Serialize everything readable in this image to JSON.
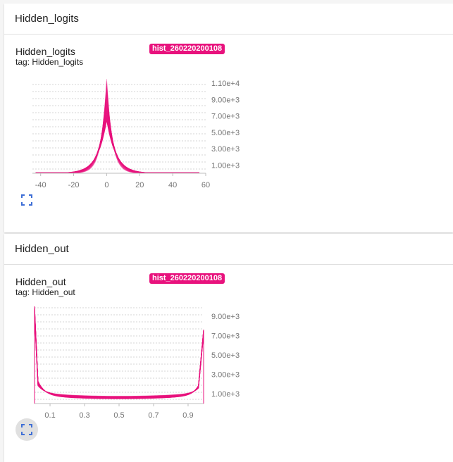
{
  "sections": [
    {
      "header": "Hidden_logits",
      "card": {
        "title": "Hidden_logits",
        "tag": "tag: Hidden_logits",
        "run": "hist_260220200108",
        "expand_icon": "fullscreen-icon"
      }
    },
    {
      "header": "Hidden_out",
      "card": {
        "title": "Hidden_out",
        "tag": "tag: Hidden_out",
        "run": "hist_260220200108",
        "expand_icon": "fullscreen-icon"
      }
    }
  ],
  "colors": {
    "run": "#e8127d",
    "curve": "#e8127d",
    "icon": "#3f6fd6"
  },
  "chart_data": [
    {
      "type": "line",
      "title": "Hidden_logits",
      "x_ticks": [
        -40,
        -20,
        0,
        20,
        40,
        60
      ],
      "y_ticks": [
        "1.00e+3",
        "3.00e+3",
        "5.00e+3",
        "7.00e+3",
        "9.00e+3",
        "1.10e+4"
      ],
      "xlim": [
        -45,
        60
      ],
      "ylim": [
        0,
        11000
      ],
      "series_count": 24,
      "peak_range": [
        6500,
        11500
      ],
      "peak_at": 0,
      "x_extent": [
        -43,
        56
      ]
    },
    {
      "type": "line",
      "title": "Hidden_out",
      "x_ticks": [
        "0.1",
        "0.3",
        "0.5",
        "0.7",
        "0.9"
      ],
      "y_ticks": [
        "1.00e+3",
        "3.00e+3",
        "5.00e+3",
        "7.00e+3",
        "9.00e+3"
      ],
      "xlim": [
        0.01,
        0.99
      ],
      "ylim": [
        0,
        10000
      ],
      "series_count": 24,
      "left_edge_peak": [
        9000,
        10000
      ],
      "right_edge_peak": [
        7100,
        7600
      ],
      "middle_floor": 500
    }
  ]
}
